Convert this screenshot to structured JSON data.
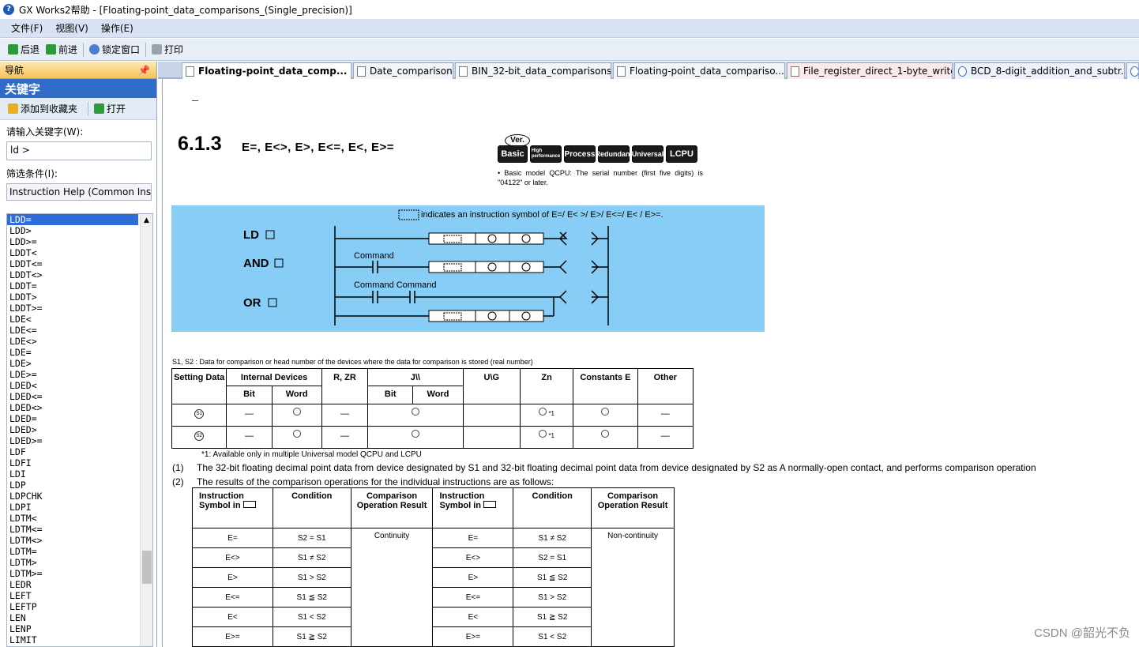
{
  "window": {
    "title": "GX Works2帮助 - [Floating-point_data_comparisons_(Single_precision)]"
  },
  "menu": [
    "文件(F)",
    "视图(V)",
    "操作(E)"
  ],
  "toolbar": {
    "back": "后退",
    "forward": "前进",
    "lock": "锁定窗口",
    "print": "打印"
  },
  "nav": {
    "header": "导航",
    "pin": "ᵖ",
    "title": "关键字",
    "add_fav": "添加到收藏夹",
    "open": "打开",
    "kw_label": "请输入关键字(W):",
    "kw_value": "ld >",
    "filter_label": "筛选条件(I):",
    "filter_value": "Instruction Help (Common Ins",
    "items": [
      "LDD=",
      "LDD>",
      "LDD>=",
      "LDDT<",
      "LDDT<=",
      "LDDT<>",
      "LDDT=",
      "LDDT>",
      "LDDT>=",
      "LDE<",
      "LDE<=",
      "LDE<>",
      "LDE=",
      "LDE>",
      "LDE>=",
      "LDED<",
      "LDED<=",
      "LDED<>",
      "LDED=",
      "LDED>",
      "LDED>=",
      "LDF",
      "LDFI",
      "LDI",
      "LDP",
      "LDPCHK",
      "LDPI",
      "LDTM<",
      "LDTM<=",
      "LDTM<>",
      "LDTM=",
      "LDTM>",
      "LDTM>=",
      "LEDR",
      "LEFT",
      "LEFTP",
      "LEN",
      "LENP",
      "LIMIT"
    ]
  },
  "tabs": [
    "Floating-point_data_comp...",
    "Date_comparison",
    "BIN_32-bit_data_comparisons",
    "Floating-point_data_compariso...",
    "File_register_direct_1-byte_write",
    "BCD_8-digit_addition_and_subtr..."
  ],
  "doc": {
    "section": "6.1.3",
    "heading": "E=,  E<>,  E>,  E<=,  E<,  E>=",
    "ver": "Ver.",
    "badges": [
      "Basic",
      "High performance",
      "Process",
      "Redundant",
      "Universal",
      "LCPU"
    ],
    "note": "•     Basic model QCPU: The serial number (first five digits) is \"04122\" or later.",
    "diagram": {
      "caption": "indicates an instruction symbol of E=/ E< >/ E>/ E<=/ E< / E>=.",
      "ld": "LD",
      "and": "AND",
      "or": "OR",
      "command": "Command",
      "command2": "Command Command",
      "s1": "S1",
      "s2": "S2"
    },
    "desc": "S1, S2   :  Data  for  comparison  or  head  number  of  the  devices  where  the  data  for  comparison  is  stored     (real  number)",
    "dev_headers": {
      "setting": "Setting Data",
      "internal": "Internal  Devices",
      "r": "R,  ZR",
      "j": "J\\\\",
      "u": "U\\G",
      "zn": "Zn",
      "const": "Constants E",
      "other": "Other",
      "bit": "Bit",
      "word": "Word"
    },
    "dev_rows": [
      {
        "d": "S1",
        "a": "—",
        "c": "—",
        "zn": "*1",
        "o": "—"
      },
      {
        "d": "S2",
        "a": "—",
        "c": "—",
        "zn": "*1",
        "o": "—"
      }
    ],
    "footnote": "*1:     Available  only  in  multiple  Universal  model  QCPU  and  LCPU",
    "p1n": "(1)",
    "p1": "The  32-bit  floating  decimal  point  data  from  device  designated  by  S1  and  32-bit  floating  decimal  point  data  from  device  designated  by  S2  as  A  normally-open  contact,  and  performs  comparison  operation",
    "p2n": "(2)",
    "p2": "The  results  of  the  comparison  operations  for  the  individual  instructions  are  as  follows:",
    "cmp_headers": {
      "instr": "Instruction Symbol  in",
      "cond": "Condition",
      "result": "Comparison Operation Result"
    },
    "cmp_left": [
      {
        "s": "E=",
        "c": "S2 = S1"
      },
      {
        "s": "E<>",
        "c": "S1 ≠ S2"
      },
      {
        "s": "E>",
        "c": "S1 > S2"
      },
      {
        "s": "E<=",
        "c": "S1 ≦ S2"
      },
      {
        "s": "E<",
        "c": "S1 < S2"
      },
      {
        "s": "E>=",
        "c": "S1 ≧ S2"
      }
    ],
    "cmp_right": [
      {
        "s": "E=",
        "c": "S1 ≠ S2"
      },
      {
        "s": "E<>",
        "c": "S2 = S1"
      },
      {
        "s": "E>",
        "c": "S1 ≦ S2"
      },
      {
        "s": "E<=",
        "c": "S1 > S2"
      },
      {
        "s": "E<",
        "c": "S1 ≧ S2"
      },
      {
        "s": "E>=",
        "c": "S1 < S2"
      }
    ],
    "left_result": "Continuity",
    "right_result": "Non-continuity"
  },
  "watermark": "CSDN @韶光不负"
}
